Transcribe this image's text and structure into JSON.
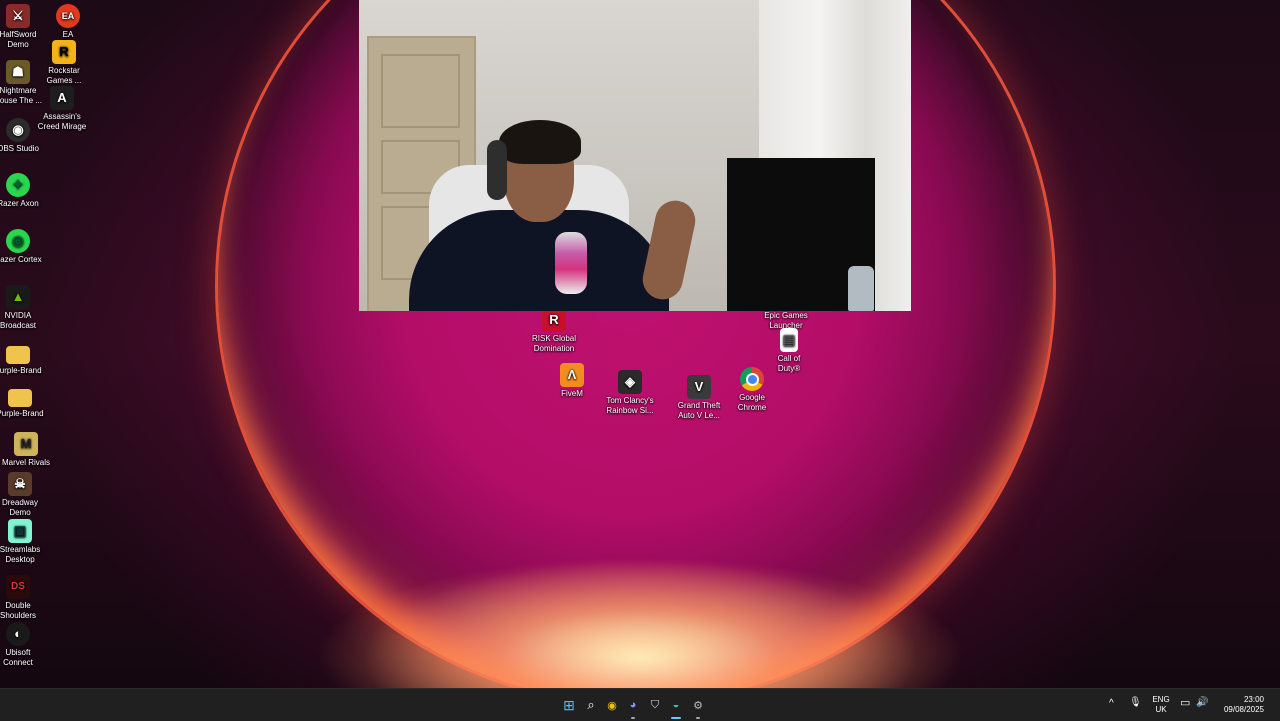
{
  "desktop_icons_left": [
    {
      "id": "halfswordemo",
      "label": "HalfSword\nDemo",
      "icon": "halfsword-icon",
      "color": "#8b2a2a",
      "glyph": "⚔"
    },
    {
      "id": "ea",
      "label": "EA",
      "icon": "ea-icon",
      "color": "#e0391d",
      "glyph": "EA"
    },
    {
      "id": "nightmare",
      "label": "Nightmare\nHouse The ...",
      "icon": "nightmare-house-icon",
      "color": "#6a5a2a",
      "glyph": "☗"
    },
    {
      "id": "rockstar",
      "label": "Rockstar\nGames ...",
      "icon": "rockstar-icon",
      "color": "#f3b21a",
      "glyph": "R"
    },
    {
      "id": "ac",
      "label": "Assassin's\nCreed Mirage",
      "icon": "assassins-creed-icon",
      "color": "#1d1d1d",
      "glyph": "A"
    },
    {
      "id": "obs",
      "label": "OBS Studio",
      "icon": "obs-icon",
      "color": "#2b2b2b",
      "glyph": "◉"
    },
    {
      "id": "axon",
      "label": "Razer Axon",
      "icon": "razer-axon-icon",
      "color": "#2bd64f",
      "glyph": "✦"
    },
    {
      "id": "cortex",
      "label": "Razer Cortex",
      "icon": "razer-cortex-icon",
      "color": "#2bd64f",
      "glyph": "◎"
    },
    {
      "id": "nvidia",
      "label": "NVIDIA\nBroadcast",
      "icon": "nvidia-icon",
      "color": "#1a1a1a",
      "glyph": "▲"
    },
    {
      "id": "pb1",
      "label": "Purple-Brand",
      "icon": "folder-icon",
      "color": "#f0c44c",
      "glyph": ""
    },
    {
      "id": "pb2",
      "label": "Purple-Brand",
      "icon": "folder-icon",
      "color": "#f0c44c",
      "glyph": ""
    },
    {
      "id": "marvel",
      "label": "Marvel Rivals",
      "icon": "marvel-rivals-icon",
      "color": "#cdb45a",
      "glyph": "M"
    },
    {
      "id": "dreadway",
      "label": "Dreadway\nDemo",
      "icon": "dreadway-icon",
      "color": "#5a3a2a",
      "glyph": "☠"
    },
    {
      "id": "streamlabs",
      "label": "Streamlabs\nDesktop",
      "icon": "streamlabs-icon",
      "color": "#80f5d2",
      "glyph": "▣"
    },
    {
      "id": "double",
      "label": "Double\nShoulders",
      "icon": "double-shoulders-icon",
      "color": "#2a0a0a",
      "glyph": "DS"
    },
    {
      "id": "ubisoft",
      "label": "Ubisoft\nConnect",
      "icon": "ubisoft-icon",
      "color": "#1a1a1a",
      "glyph": "◐"
    }
  ],
  "desktop_icons_center": [
    {
      "id": "epic",
      "label": "Epic Games\nLauncher",
      "icon": "epic-games-icon",
      "color": "#222",
      "glyph": "E"
    },
    {
      "id": "risk",
      "label": "RISK Global\nDomination",
      "icon": "risk-icon",
      "color": "#c8102e",
      "glyph": "R"
    },
    {
      "id": "cod",
      "label": "Call of\nDuty®",
      "icon": "call-of-duty-icon",
      "color": "#ffffff",
      "glyph": "▤"
    },
    {
      "id": "fivem",
      "label": "FiveM",
      "icon": "fivem-icon",
      "color": "#f28c1f",
      "glyph": "Λ"
    },
    {
      "id": "r6",
      "label": "Tom Clancy's\nRainbow Si...",
      "icon": "rainbow-six-icon",
      "color": "#2a2a2a",
      "glyph": "◈"
    },
    {
      "id": "gta",
      "label": "Grand Theft\nAuto V Le...",
      "icon": "gta-v-icon",
      "color": "#3a3a3a",
      "glyph": "V"
    },
    {
      "id": "chrome",
      "label": "Google\nChrome",
      "icon": "chrome-icon",
      "color": "#ffffff",
      "glyph": "◉"
    }
  ],
  "taskbar": {
    "items": [
      {
        "name": "start-button-icon",
        "glyph": "⊞",
        "color": "#4cc2ff"
      },
      {
        "name": "search-icon",
        "glyph": "⌕",
        "color": "#ffffff"
      },
      {
        "name": "chrome-taskbar-icon",
        "glyph": "◉",
        "color": "#f2c200"
      },
      {
        "name": "discord-taskbar-icon",
        "glyph": "◕",
        "color": "#5865f2"
      },
      {
        "name": "shield-taskbar-icon",
        "glyph": "⛉",
        "color": "#cfd8ff"
      },
      {
        "name": "edge-taskbar-icon",
        "glyph": "◒",
        "color": "#35c4a8"
      },
      {
        "name": "settings-taskbar-icon",
        "glyph": "⚙",
        "color": "#bbbbbb"
      }
    ],
    "tray": {
      "chevron": "^",
      "mic": "🎙",
      "lang_top": "ENG",
      "lang_bottom": "UK",
      "network": "▭",
      "volume": "🔊",
      "time": "23:00",
      "date": "09/08/2025"
    }
  }
}
